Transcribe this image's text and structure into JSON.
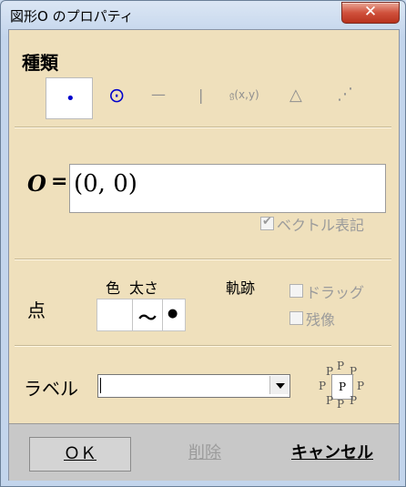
{
  "window": {
    "title": "図形O のプロパティ",
    "close_label": "✕"
  },
  "kind": {
    "heading": "種類",
    "tools": [
      {
        "name": "point-tool",
        "glyph": "•"
      },
      {
        "name": "circle-point-tool",
        "glyph": "⊙"
      },
      {
        "name": "line-tool",
        "glyph": "—"
      },
      {
        "name": "vertical-line-tool",
        "glyph": "|"
      },
      {
        "name": "function-tool",
        "glyph": "𝔤(x,y)"
      },
      {
        "name": "triangle-tool",
        "glyph": "△"
      },
      {
        "name": "scatter-tool",
        "glyph": "⋰"
      }
    ]
  },
  "object": {
    "name": "O",
    "equals": "=",
    "value": "(0,  0)",
    "vector_label": "ベクトル表記",
    "vector_checked": true
  },
  "point": {
    "label": "点",
    "color_label": "色",
    "thickness_label": "太さ",
    "trace_label": "軌跡",
    "wave_glyph": "〜",
    "dot_glyph": "●",
    "drag_label": "ドラッグ",
    "residue_label": "残像"
  },
  "label": {
    "label": "ラベル",
    "value": "",
    "position_glyph": "P"
  },
  "buttons": {
    "ok": "ＯＫ",
    "delete": "削除",
    "cancel": "キャンセル"
  },
  "colors": {
    "panel": "#efe0bc",
    "point": "#0000cc"
  }
}
